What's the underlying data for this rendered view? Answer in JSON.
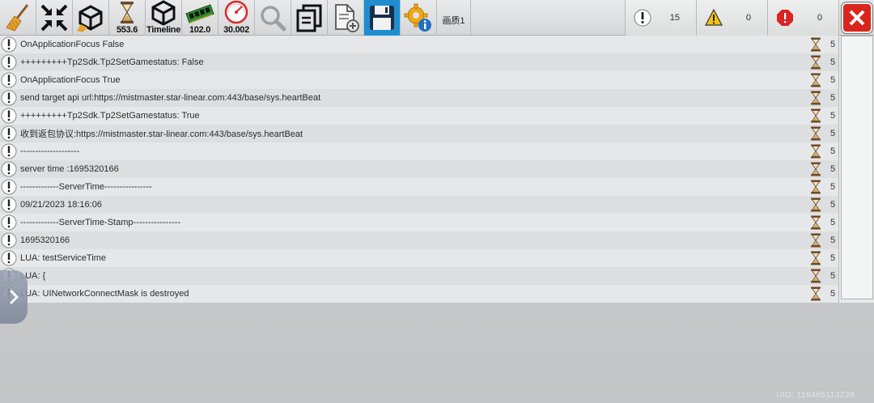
{
  "toolbar": {
    "timer_value": "553.6",
    "timeline_label": "Timeline",
    "memory_value": "102.0",
    "fps_value": "30.002",
    "quality_label": "画质1"
  },
  "counters": {
    "info": "15",
    "warning": "0",
    "error": "0"
  },
  "colors": {
    "accent_blue": "#1f8ed1",
    "close_red": "#d9261c",
    "warning_yellow": "#f2c20f",
    "error_red": "#d82424"
  },
  "logs": [
    {
      "text": "OnApplicationFocus False",
      "num": "5"
    },
    {
      "text": "+++++++++Tp2Sdk.Tp2SetGamestatus: False",
      "num": "5"
    },
    {
      "text": "OnApplicationFocus True",
      "num": "5"
    },
    {
      "text": "send target api url:https://mistmaster.star-linear.com:443/base/sys.heartBeat",
      "num": "5"
    },
    {
      "text": "+++++++++Tp2Sdk.Tp2SetGamestatus: True",
      "num": "5"
    },
    {
      "text": "收到返包协议:https://mistmaster.star-linear.com:443/base/sys.heartBeat",
      "num": "5"
    },
    {
      "text": "--------------------",
      "num": "5"
    },
    {
      "text": "server time :1695320166",
      "num": "5"
    },
    {
      "text": "-------------ServerTime----------------",
      "num": "5"
    },
    {
      "text": "09/21/2023 18:16:06",
      "num": "5"
    },
    {
      "text": "-------------ServerTime-Stamp----------------",
      "num": "5"
    },
    {
      "text": "1695320166",
      "num": "5"
    },
    {
      "text": "LUA: testServiceTime",
      "num": "5"
    },
    {
      "text": "LUA: {",
      "num": "5"
    },
    {
      "text": "LUA: UINetworkConnectMask is destroyed",
      "num": "5"
    }
  ],
  "watermark": "UID: 116465113239"
}
